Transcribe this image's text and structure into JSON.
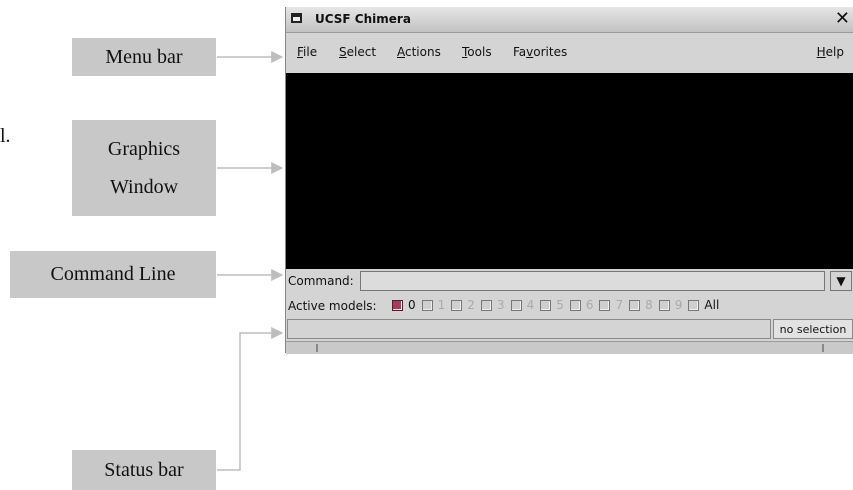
{
  "callouts": {
    "menu_bar": "Menu bar",
    "graphics_line1": "Graphics",
    "graphics_line2": "Window",
    "command_line": "Command Line",
    "status_bar": "Status bar",
    "stray_text": "l."
  },
  "window": {
    "title": "UCSF Chimera",
    "close_glyph": "✕",
    "menu": {
      "file": {
        "accel": "F",
        "rest": "ile"
      },
      "select": {
        "accel": "S",
        "rest": "elect"
      },
      "actions": {
        "accel": "A",
        "rest": "ctions"
      },
      "tools": {
        "accel": "T",
        "rest": "ools"
      },
      "favorites": {
        "pre": "Fa",
        "accel": "v",
        "rest": "orites"
      },
      "help": {
        "accel": "H",
        "rest": "elp"
      }
    },
    "command": {
      "label": "Command:",
      "value": "",
      "dropdown_glyph": "▼"
    },
    "active_models": {
      "label": "Active models:",
      "models": [
        {
          "label": "0",
          "checked": true
        },
        {
          "label": "1",
          "checked": false
        },
        {
          "label": "2",
          "checked": false
        },
        {
          "label": "3",
          "checked": false
        },
        {
          "label": "4",
          "checked": false
        },
        {
          "label": "5",
          "checked": false
        },
        {
          "label": "6",
          "checked": false
        },
        {
          "label": "7",
          "checked": false
        },
        {
          "label": "8",
          "checked": false
        },
        {
          "label": "9",
          "checked": false
        },
        {
          "label": "All",
          "checked": false,
          "enabled": true
        }
      ]
    },
    "status": {
      "message": "",
      "selection": "no selection"
    }
  },
  "colors": {
    "graphics_bg": "#000000",
    "checked_model": "#a83a5c",
    "callout_bg": "#c8c8c8"
  }
}
